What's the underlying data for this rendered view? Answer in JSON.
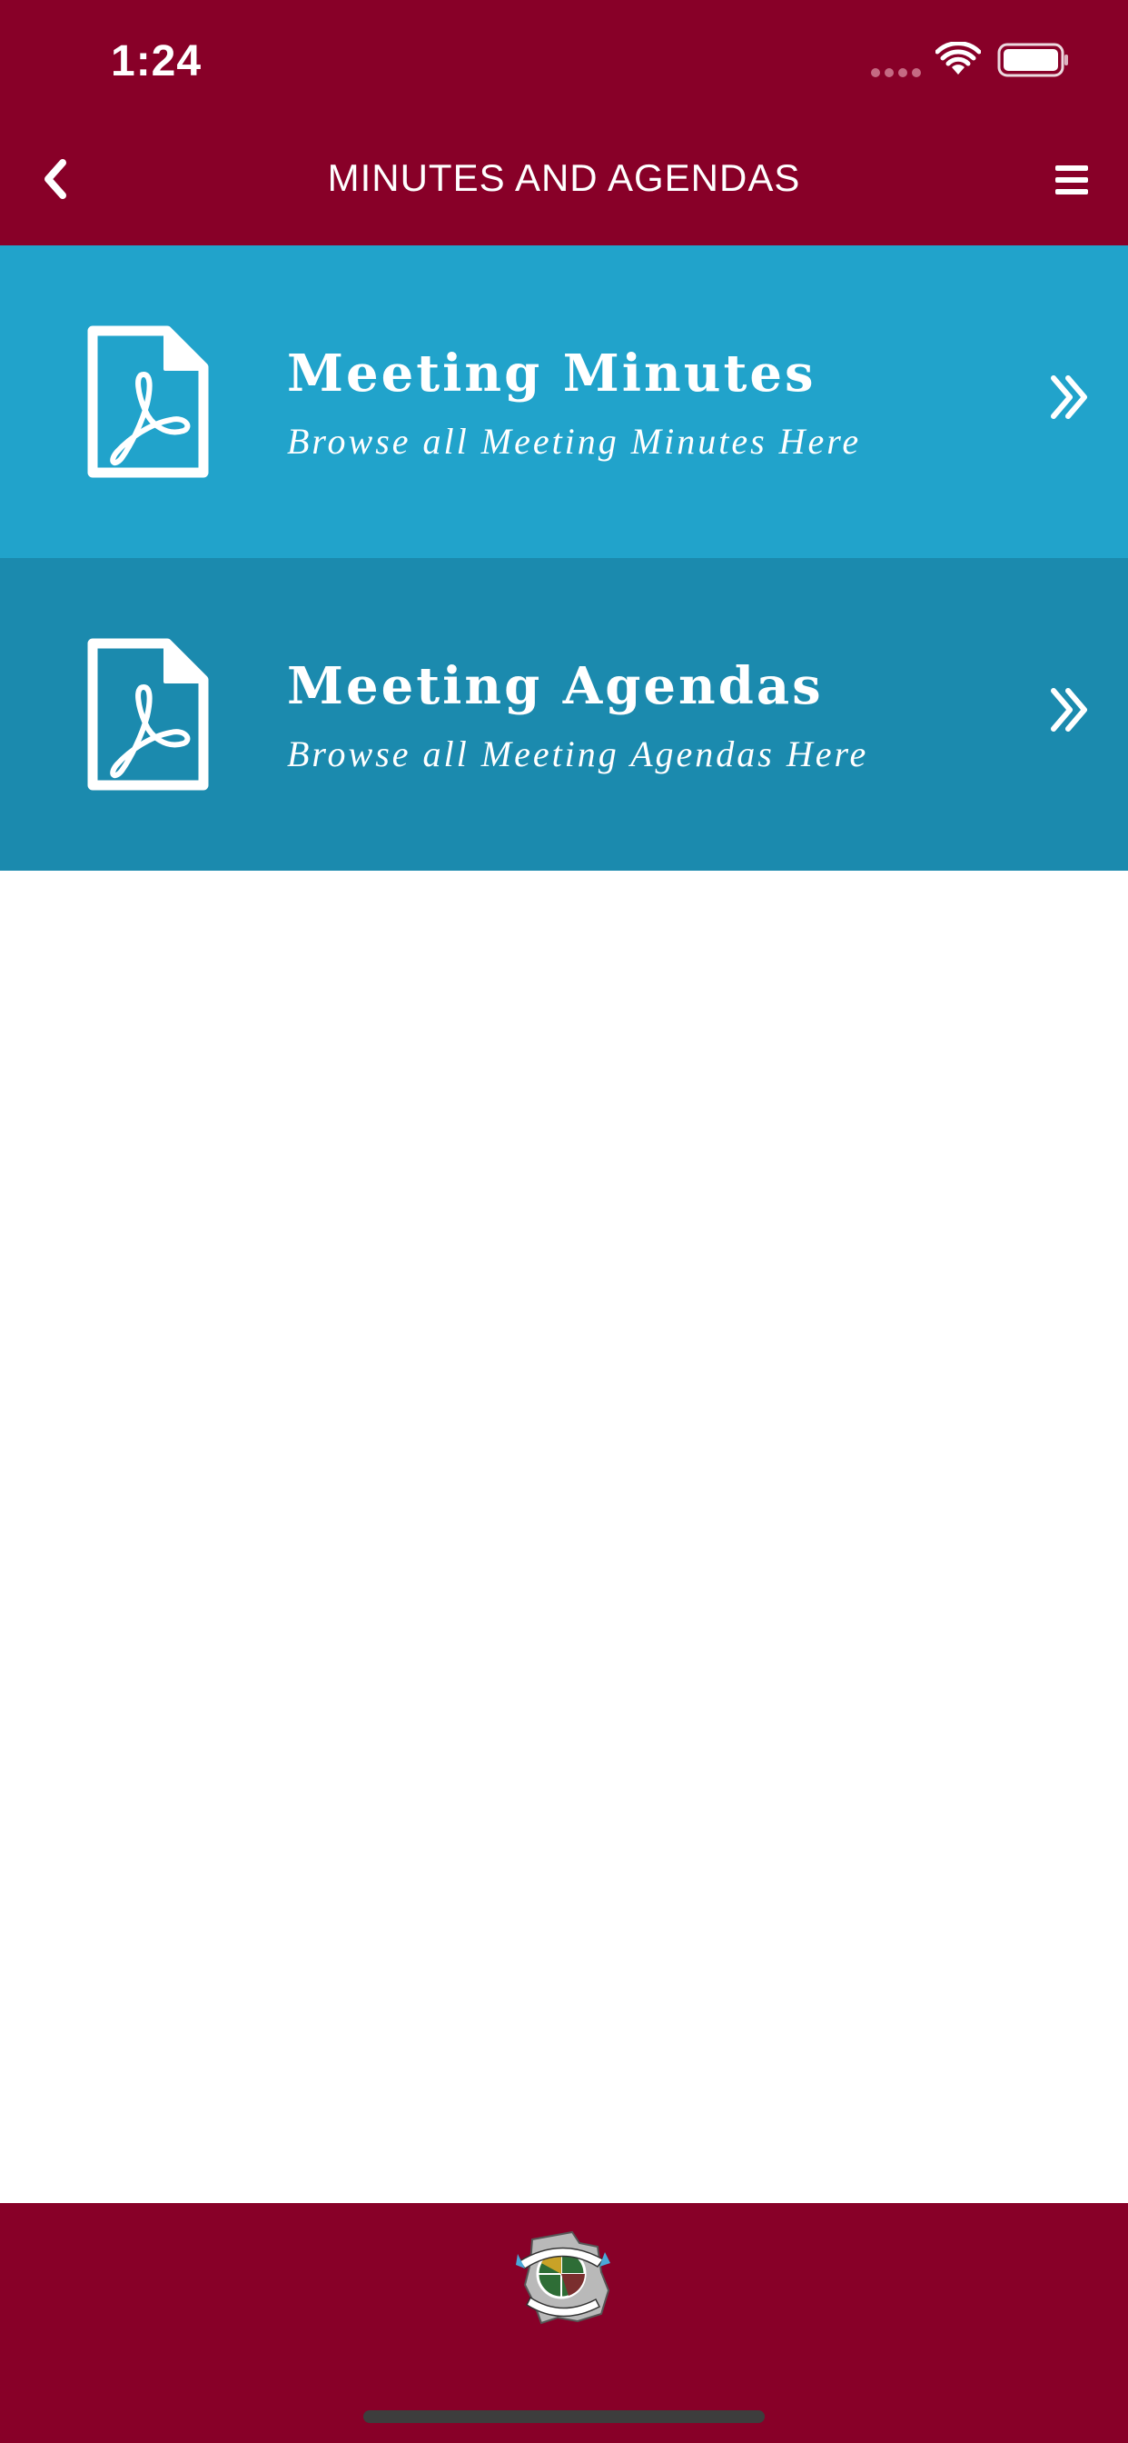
{
  "status_bar": {
    "time": "1:24"
  },
  "header": {
    "title": "MINUTES AND AGENDAS",
    "back_icon": "chevron-left-icon",
    "menu_icon": "hamburger-menu-icon"
  },
  "rows": [
    {
      "title": "Meeting Minutes",
      "subtitle": "Browse all Meeting Minutes Here",
      "icon": "pdf-file-icon",
      "color": "#21a3cb"
    },
    {
      "title": "Meeting Agendas",
      "subtitle": "Browse all Meeting Agendas Here",
      "icon": "pdf-file-icon",
      "color": "#1b8aae"
    }
  ],
  "colors": {
    "brand": "#880028",
    "row_primary": "#21a3cb",
    "row_secondary": "#1b8aae",
    "text": "#ffffff"
  }
}
